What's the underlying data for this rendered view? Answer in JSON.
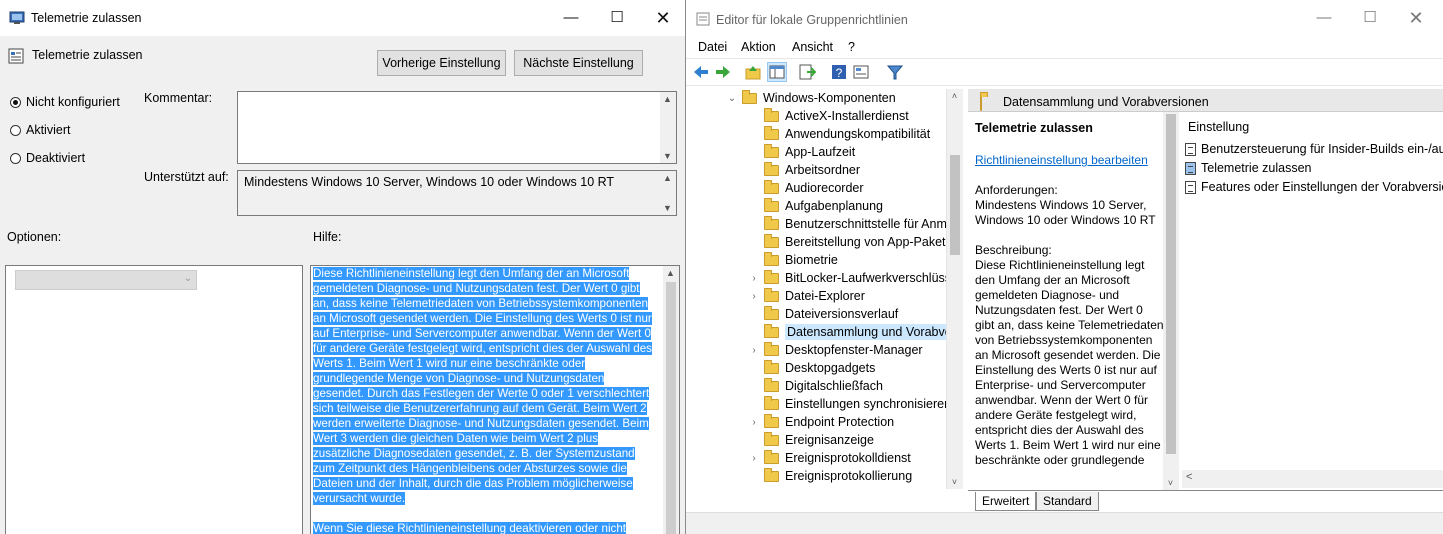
{
  "dialog": {
    "title": "Telemetrie zulassen",
    "policy_name": "Telemetrie zulassen",
    "prev_button": "Vorherige Einstellung",
    "next_button": "Nächste Einstellung",
    "radios": [
      {
        "label": "Nicht konfiguriert",
        "selected": true
      },
      {
        "label": "Aktiviert",
        "selected": false
      },
      {
        "label": "Deaktiviert",
        "selected": false
      }
    ],
    "comment_label": "Kommentar:",
    "comment_value": "",
    "supported_label": "Unterstützt auf:",
    "supported_value": "Mindestens Windows 10 Server, Windows 10 oder Windows 10 RT",
    "options_label": "Optionen:",
    "help_label": "Hilfe:",
    "help_paragraph_1": "Diese Richtlinieneinstellung legt den Umfang der an Microsoft gemeldeten Diagnose- und Nutzungsdaten fest. Der Wert 0 gibt an, dass keine Telemetriedaten von Betriebssystemkomponenten an Microsoft gesendet werden. Die Einstellung des Werts 0 ist nur auf Enterprise- und Servercomputer anwendbar. Wenn der Wert 0 für andere Geräte festgelegt wird, entspricht dies der Auswahl des Werts 1. Beim Wert 1 wird nur eine beschränkte oder grundlegende Menge von Diagnose- und Nutzungsdaten gesendet. Durch das Festlegen der Werte 0 oder 1 verschlechtert sich teilweise die Benutzererfahrung auf dem Gerät. Beim Wert 2 werden erweiterte Diagnose- und Nutzungsdaten gesendet. Beim Wert 3 werden die gleichen Daten wie beim Wert 2 plus zusätzliche Diagnosedaten gesendet, z. B. der Systemzustand zum Zeitpunkt des Hängenbleibens oder Absturzes sowie die Dateien und der Inhalt, durch die das Problem möglicherweise verursacht wurde.",
    "help_paragraph_2": "Wenn Sie diese Richtlinieneinstellung deaktivieren oder nicht"
  },
  "editor": {
    "title": "Editor für lokale Gruppenrichtlinien",
    "menu": [
      "Datei",
      "Aktion",
      "Ansicht",
      "?"
    ],
    "tree": [
      {
        "label": "Windows-Komponenten",
        "expander": "open",
        "level": 0
      },
      {
        "label": "ActiveX-Installerdienst",
        "expander": "",
        "level": 1
      },
      {
        "label": "Anwendungskompatibilität",
        "expander": "",
        "level": 1
      },
      {
        "label": "App-Laufzeit",
        "expander": "",
        "level": 1
      },
      {
        "label": "Arbeitsordner",
        "expander": "",
        "level": 1
      },
      {
        "label": "Audiorecorder",
        "expander": "",
        "level": 1
      },
      {
        "label": "Aufgabenplanung",
        "expander": "",
        "level": 1
      },
      {
        "label": "Benutzerschnittstelle für Anm",
        "expander": "",
        "level": 1
      },
      {
        "label": "Bereitstellung von App-Paketen",
        "expander": "",
        "level": 1
      },
      {
        "label": "Biometrie",
        "expander": "",
        "level": 1
      },
      {
        "label": "BitLocker-Laufwerkverschlüss",
        "expander": "closed",
        "level": 1
      },
      {
        "label": "Datei-Explorer",
        "expander": "closed",
        "level": 1
      },
      {
        "label": "Dateiversionsverlauf",
        "expander": "",
        "level": 1
      },
      {
        "label": "Datensammlung und Vorabve",
        "expander": "",
        "level": 1,
        "selected": true
      },
      {
        "label": "Desktopfenster-Manager",
        "expander": "closed",
        "level": 1
      },
      {
        "label": "Desktopgadgets",
        "expander": "",
        "level": 1
      },
      {
        "label": "Digitalschließfach",
        "expander": "",
        "level": 1
      },
      {
        "label": "Einstellungen synchronisieren",
        "expander": "",
        "level": 1
      },
      {
        "label": "Endpoint Protection",
        "expander": "closed",
        "level": 1
      },
      {
        "label": "Ereignisanzeige",
        "expander": "",
        "level": 1
      },
      {
        "label": "Ereignisprotokolldienst",
        "expander": "closed",
        "level": 1
      },
      {
        "label": "Ereignisprotokollierung",
        "expander": "",
        "level": 1
      }
    ],
    "pane_header": "Datensammlung und Vorabversionen",
    "selected_setting_title": "Telemetrie zulassen",
    "edit_link": "Richtlinieneinstellung bearbeiten",
    "requirements_label": "Anforderungen:",
    "requirements_value": "Mindestens Windows 10 Server, Windows 10 oder Windows 10 RT",
    "description_label": "Beschreibung:",
    "description_value": "Diese Richtlinieneinstellung legt den Umfang der an Microsoft gemeldeten Diagnose- und Nutzungsdaten fest. Der Wert 0 gibt an, dass keine Telemetriedaten von Betriebssystemkomponenten an Microsoft gesendet werden. Die Einstellung des Werts 0 ist nur auf Enterprise- und Servercomputer anwendbar. Wenn der Wert 0 für andere Geräte festgelegt wird, entspricht dies der Auswahl des Werts 1. Beim Wert 1 wird nur eine beschränkte oder grundlegende",
    "column_header": "Einstellung",
    "settings": [
      {
        "label": "Benutzersteuerung für Insider-Builds ein-/aus",
        "selected": false
      },
      {
        "label": "Telemetrie zulassen",
        "selected": true
      },
      {
        "label": "Features oder Einstellungen der Vorabversion",
        "selected": false
      }
    ],
    "tabs": [
      "Erweitert",
      "Standard"
    ]
  }
}
